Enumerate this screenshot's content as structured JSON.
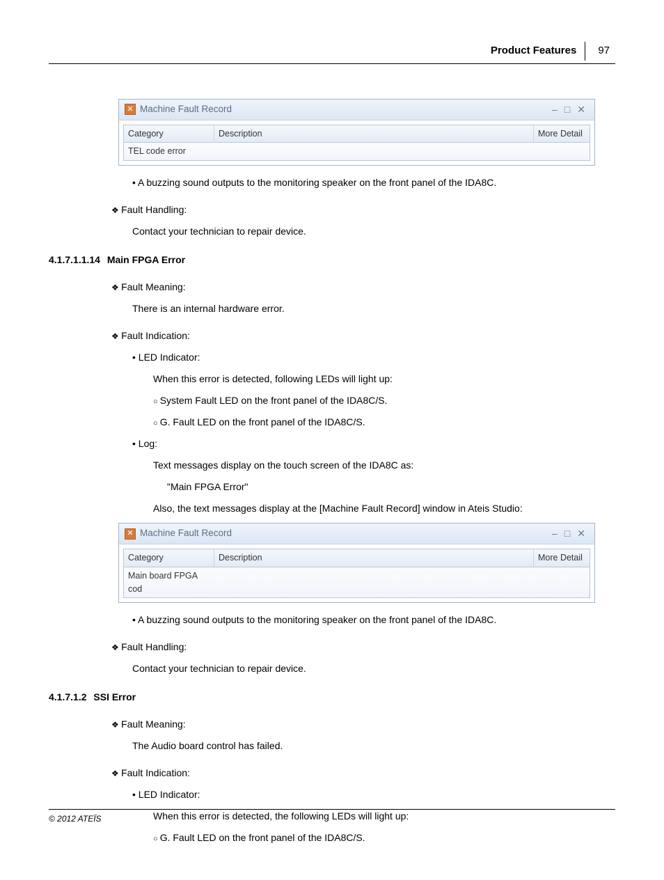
{
  "header": {
    "title": "Product Features",
    "page_number": "97"
  },
  "window1": {
    "title": "Machine Fault Record",
    "min": "–",
    "max": "□",
    "close": "✕",
    "cols": {
      "c1": "Category",
      "c2": "Description",
      "c3": "More Detail"
    },
    "row": {
      "c1": "TEL code error",
      "c2": "",
      "c3": ""
    }
  },
  "top_block": {
    "buzz": "A buzzing sound outputs to the monitoring speaker on the front panel of the IDA8C.",
    "fault_handling_label": "Fault Handling:",
    "fault_handling_text": "Contact your technician to repair device."
  },
  "sec14": {
    "num": "4.1.7.1.1.14",
    "title": "Main FPGA Error",
    "fault_meaning_label": "Fault Meaning:",
    "fault_meaning_text": "There is an internal hardware error.",
    "fault_indication_label": "Fault Indication:",
    "led_label": "LED Indicator:",
    "led_intro": "When this error is detected, following LEDs will light up:",
    "led1": "System Fault LED on the front panel of the IDA8C/S.",
    "led2": "G. Fault LED on the front panel of the IDA8C/S.",
    "log_label": "Log:",
    "log_intro": "Text messages display on the touch screen of the IDA8C as:",
    "log_quote": "\"Main FPGA Error\"",
    "log_also": "Also, the text messages display at the [Machine Fault Record] window in Ateis Studio:",
    "buzz": "A buzzing sound outputs to the monitoring speaker on the front panel of the IDA8C.",
    "fault_handling_label": "Fault Handling:",
    "fault_handling_text": "Contact your technician to repair device."
  },
  "window2": {
    "title": "Machine Fault Record",
    "min": "–",
    "max": "□",
    "close": "✕",
    "cols": {
      "c1": "Category",
      "c2": "Description",
      "c3": "More Detail"
    },
    "row": {
      "c1": "Main board FPGA cod",
      "c2": "",
      "c3": ""
    }
  },
  "sec2": {
    "num": "4.1.7.1.2",
    "title": "SSI Error",
    "fault_meaning_label": "Fault Meaning:",
    "fault_meaning_text": "The Audio board control has failed.",
    "fault_indication_label": "Fault Indication:",
    "led_label": "LED Indicator:",
    "led_intro": "When this error is detected, the following LEDs will light up:",
    "led1": "G. Fault LED on the front panel of the IDA8C/S."
  },
  "footer": "© 2012 ATEÏS"
}
